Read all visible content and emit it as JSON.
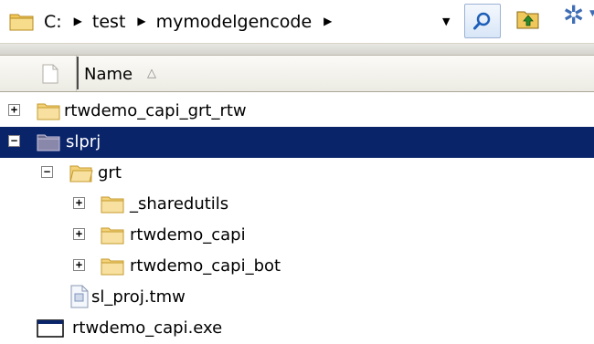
{
  "address": {
    "crumbs": [
      "C:",
      "test",
      "mymodelgencode"
    ],
    "separator": "▶",
    "dropdown_glyph": "▼",
    "icons": [
      "folder-icon",
      "search-icon",
      "folder-up-icon",
      "gear-icon"
    ]
  },
  "header": {
    "name_label": "Name",
    "sort_indicator": "△"
  },
  "tree": [
    {
      "label": "rtwdemo_capi_grt_rtw",
      "icon": "folder-icon",
      "expander": "+",
      "selected": false
    },
    {
      "label": "slprj",
      "icon": "folder-icon",
      "expander": "−",
      "selected": true
    },
    {
      "label": "grt",
      "icon": "folder-open-icon",
      "expander": "−",
      "selected": false
    },
    {
      "label": "_sharedutils",
      "icon": "folder-icon",
      "expander": "+",
      "selected": false
    },
    {
      "label": "rtwdemo_capi",
      "icon": "folder-icon",
      "expander": "+",
      "selected": false
    },
    {
      "label": "rtwdemo_capi_bot",
      "icon": "folder-icon",
      "expander": "+",
      "selected": false
    },
    {
      "label": "sl_proj.tmw",
      "icon": "file-icon",
      "expander": "",
      "selected": false
    },
    {
      "label": "rtwdemo_capi.exe",
      "icon": "exe-window-icon",
      "expander": "",
      "selected": false
    }
  ],
  "colors": {
    "selection": "#0a246a",
    "folder": "#f3d27a",
    "accent": "#3e6db3"
  }
}
